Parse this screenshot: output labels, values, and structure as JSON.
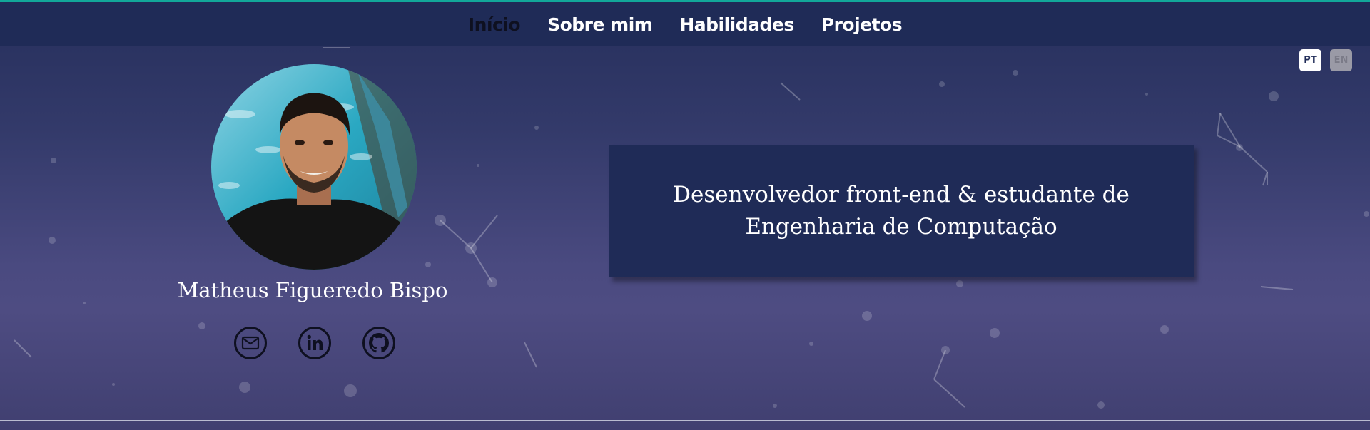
{
  "nav": {
    "items": [
      {
        "label": "Início",
        "active": true
      },
      {
        "label": "Sobre mim",
        "active": false
      },
      {
        "label": "Habilidades",
        "active": false
      },
      {
        "label": "Projetos",
        "active": false
      }
    ]
  },
  "language": {
    "pt": "PT",
    "en": "EN",
    "active": "PT"
  },
  "profile": {
    "name": "Matheus Figueredo Bispo",
    "socials": [
      {
        "icon": "mail-icon"
      },
      {
        "icon": "linkedin-icon"
      },
      {
        "icon": "github-icon"
      }
    ]
  },
  "headline": {
    "line1": "Desenvolvedor front-end & estudante de",
    "line2": "Engenharia de Computação"
  },
  "colors": {
    "navbar": "#1f2b57",
    "accent_top": "#12a89a",
    "active_link": "#0e1020",
    "text": "#ffffff"
  }
}
